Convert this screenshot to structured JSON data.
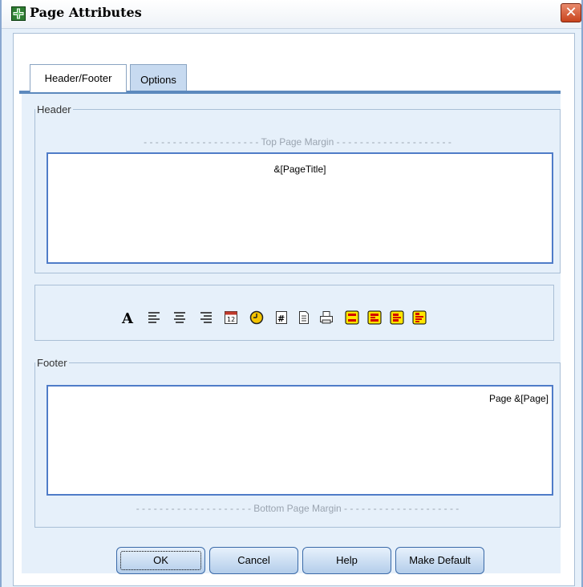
{
  "window": {
    "title": "Page Attributes"
  },
  "tabs": [
    {
      "label": "Header/Footer",
      "active": true
    },
    {
      "label": "Options",
      "active": false
    }
  ],
  "header": {
    "group_label": "Header",
    "margin_label": "- - - - - - - - - - - - - - - - - - - - Top Page Margin - - - - - - - - - - - - - - - - - - - -",
    "content": "&[PageTitle]"
  },
  "toolbar": {
    "icons": [
      "font-icon",
      "align-left-icon",
      "align-center-icon",
      "align-right-icon",
      "date-icon",
      "time-icon",
      "page-number-icon",
      "filename-icon",
      "print-icon",
      "header-format-1-icon",
      "header-format-2-icon",
      "header-format-3-icon",
      "header-format-4-icon"
    ]
  },
  "footer": {
    "group_label": "Footer",
    "margin_label": "- - - - - - - - - - - - - - - - - - - - Bottom Page Margin - - - - - - - - - - - - - - - - - - - -",
    "content": "Page &[Page]"
  },
  "buttons": {
    "ok": "OK",
    "cancel": "Cancel",
    "help": "Help",
    "make_default": "Make Default"
  },
  "colors": {
    "panel": "#e6f0fa",
    "accent": "#5c89bd",
    "textarea_border": "#4f7cc8",
    "header_icon_fill": "#ffe600",
    "header_icon_red": "#d40000"
  }
}
